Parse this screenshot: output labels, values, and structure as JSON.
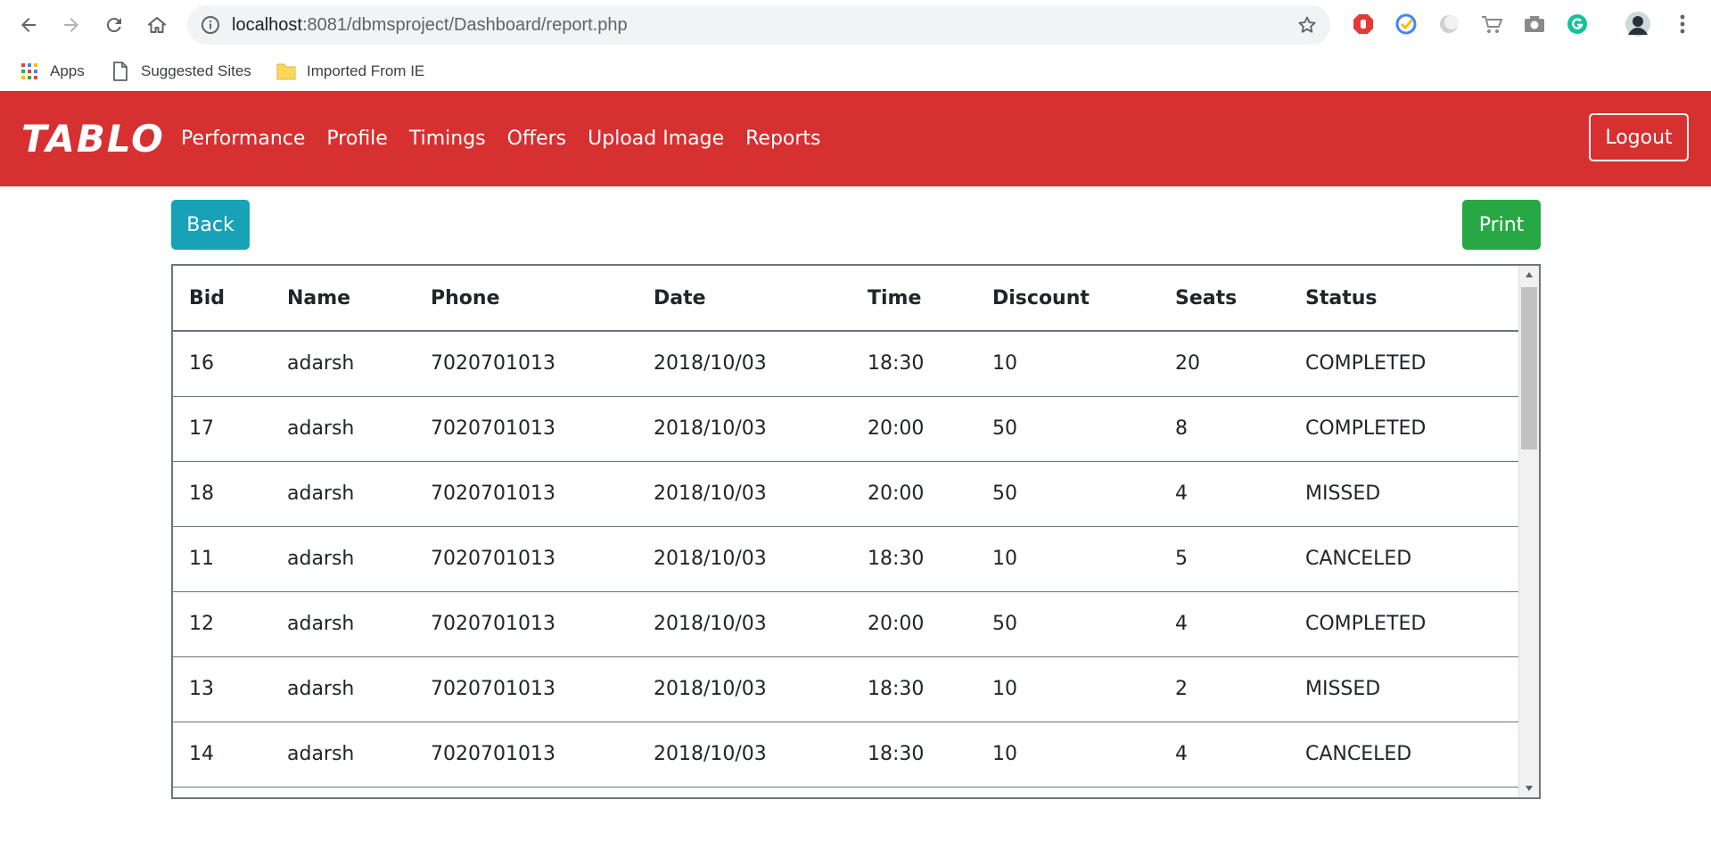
{
  "browser": {
    "url_host": "localhost",
    "url_path": ":8081/dbmsproject/Dashboard/report.php",
    "bookmarks": [
      "Apps",
      "Suggested Sites",
      "Imported From IE"
    ]
  },
  "navbar": {
    "brand": "TABLO",
    "links": [
      "Performance",
      "Profile",
      "Timings",
      "Offers",
      "Upload Image",
      "Reports"
    ],
    "logout": "Logout"
  },
  "actions": {
    "back": "Back",
    "print": "Print"
  },
  "table": {
    "headers": [
      "Bid",
      "Name",
      "Phone",
      "Date",
      "Time",
      "Discount",
      "Seats",
      "Status"
    ],
    "rows": [
      [
        "16",
        "adarsh",
        "7020701013",
        "2018/10/03",
        "18:30",
        "10",
        "20",
        "COMPLETED"
      ],
      [
        "17",
        "adarsh",
        "7020701013",
        "2018/10/03",
        "20:00",
        "50",
        "8",
        "COMPLETED"
      ],
      [
        "18",
        "adarsh",
        "7020701013",
        "2018/10/03",
        "20:00",
        "50",
        "4",
        "MISSED"
      ],
      [
        "11",
        "adarsh",
        "7020701013",
        "2018/10/03",
        "18:30",
        "10",
        "5",
        "CANCELED"
      ],
      [
        "12",
        "adarsh",
        "7020701013",
        "2018/10/03",
        "20:00",
        "50",
        "4",
        "COMPLETED"
      ],
      [
        "13",
        "adarsh",
        "7020701013",
        "2018/10/03",
        "18:30",
        "10",
        "2",
        "MISSED"
      ],
      [
        "14",
        "adarsh",
        "7020701013",
        "2018/10/03",
        "18:30",
        "10",
        "4",
        "CANCELED"
      ],
      [
        "",
        "",
        "",
        "",
        "",
        "",
        "",
        ""
      ]
    ]
  },
  "colors": {
    "navbar": "#d63031",
    "back_button": "#17a2b8",
    "print_button": "#28a745"
  },
  "icons": [
    "back-arrow-icon",
    "forward-arrow-icon",
    "reload-icon",
    "home-icon",
    "info-icon",
    "star-icon",
    "apps-grid-icon",
    "page-icon",
    "folder-icon"
  ]
}
